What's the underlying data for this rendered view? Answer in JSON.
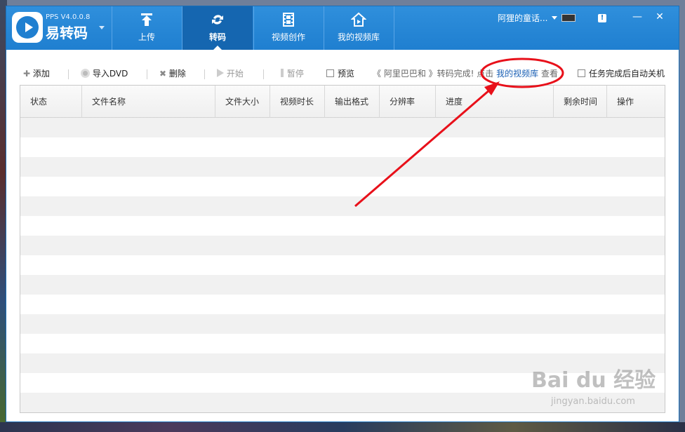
{
  "app": {
    "version": "PPS V4.0.0.8",
    "name": "易转码"
  },
  "nav": {
    "tabs": [
      {
        "label": "上传",
        "icon": "upload-icon"
      },
      {
        "label": "转码",
        "icon": "convert-icon",
        "active": true
      },
      {
        "label": "视频创作",
        "icon": "film-icon"
      },
      {
        "label": "我的视频库",
        "icon": "home-library-icon"
      }
    ]
  },
  "header": {
    "user_name": "阿狸的童话...",
    "notice_icon": "alert-icon",
    "minimize": "—",
    "close": "✕"
  },
  "toolbar": {
    "add": "添加",
    "import_dvd": "导入DVD",
    "delete": "删除",
    "start": "开始",
    "pause": "暂停",
    "preview": "预览",
    "marquee_prefix": "《 阿里巴巴和 》转码完成! 点击",
    "marquee_link": "我的视频库",
    "marquee_suffix": "查看",
    "auto_shutdown": "任务完成后自动关机"
  },
  "table": {
    "columns": [
      "状态",
      "文件名称",
      "文件大小",
      "视频时长",
      "输出格式",
      "分辨率",
      "进度",
      "剩余时间",
      "操作"
    ],
    "rows": []
  },
  "watermark": {
    "logo": "Bai du 经验",
    "url": "jingyan.baidu.com"
  },
  "colors": {
    "header": "#1f7fd0",
    "active_tab": "#1566b0",
    "annotation": "#e8101a"
  }
}
